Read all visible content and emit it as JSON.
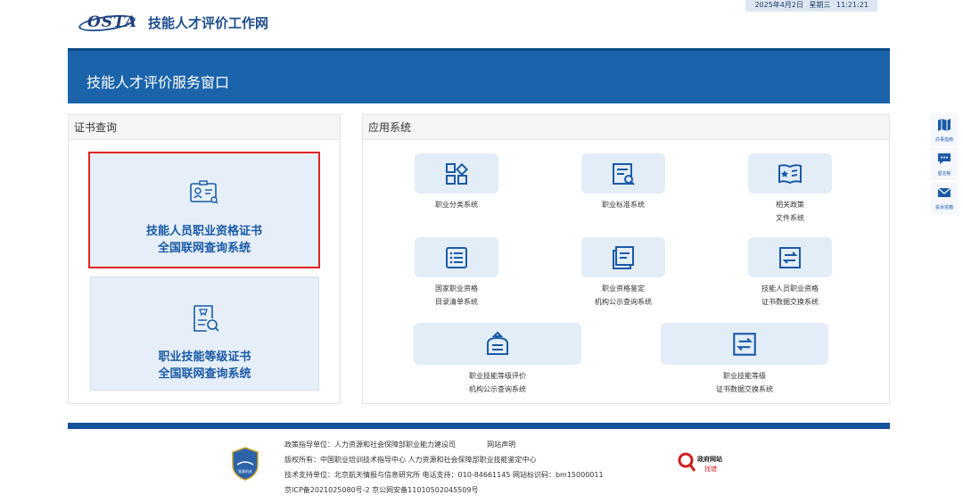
{
  "header": {
    "logo_text": "OSTA",
    "site_title": "技能人才评价工作网",
    "datetime": "2025年4月2日  星期三 11:21:21"
  },
  "banner": {
    "title": "技能人才评价服务窗口"
  },
  "cert_panel": {
    "title": "证书查询",
    "cards": [
      {
        "line1": "技能人员职业资格证书",
        "line2": "全国联网查询系统"
      },
      {
        "line1": "职业技能等级证书",
        "line2": "全国联网查询系统"
      }
    ]
  },
  "apps_panel": {
    "title": "应用系统",
    "items": [
      {
        "line1": "职业分类系统",
        "line2": "",
        "icon": "grid-icon"
      },
      {
        "line1": "职业标准系统",
        "line2": "",
        "icon": "standard-search-icon"
      },
      {
        "line1": "相关政策",
        "line2": "文件系统",
        "icon": "policy-star-icon"
      },
      {
        "line1": "国家职业资格",
        "line2": "目录清单系统",
        "icon": "list-icon"
      },
      {
        "line1": "职业资格鉴定",
        "line2": "机构公示查询系统",
        "icon": "document-stack-icon"
      },
      {
        "line1": "技能人员职业资格",
        "line2": "证书数据交换系统",
        "icon": "exchange-icon"
      },
      {
        "line1": "职业技能等级评价",
        "line2": "机构公示查询系统",
        "icon": "institution-icon"
      },
      {
        "line1": "职业技能等级",
        "line2": "证书数据交换系统",
        "icon": "exchange-icon"
      }
    ]
  },
  "footer": {
    "line1": "政策指导单位：人力资源和社会保障部职业能力建设司",
    "line1_link": "网站声明",
    "line2": "版权所有：中国职业培训技术指导中心  人力资源和社会保障部职业技能鉴定中心",
    "line3": "技术支持单位：北京航天情报与信息研究所   电话支持：010-84661145   网站标识码：bm15000011",
    "line4": "京ICP备2021025080号-2    京公网安备11010502045509号",
    "badge_text": "党政机关",
    "gov_line1": "政府网站",
    "gov_line2": "找错"
  },
  "side_tools": [
    {
      "label": "办事指南",
      "icon": "map-icon"
    },
    {
      "label": "留言板",
      "icon": "chat-icon"
    },
    {
      "label": "投诉信箱",
      "icon": "mail-icon"
    }
  ],
  "colors": {
    "brand_blue": "#1b64ac",
    "card_bg": "#e6eff9",
    "highlight_red": "#e02424"
  }
}
